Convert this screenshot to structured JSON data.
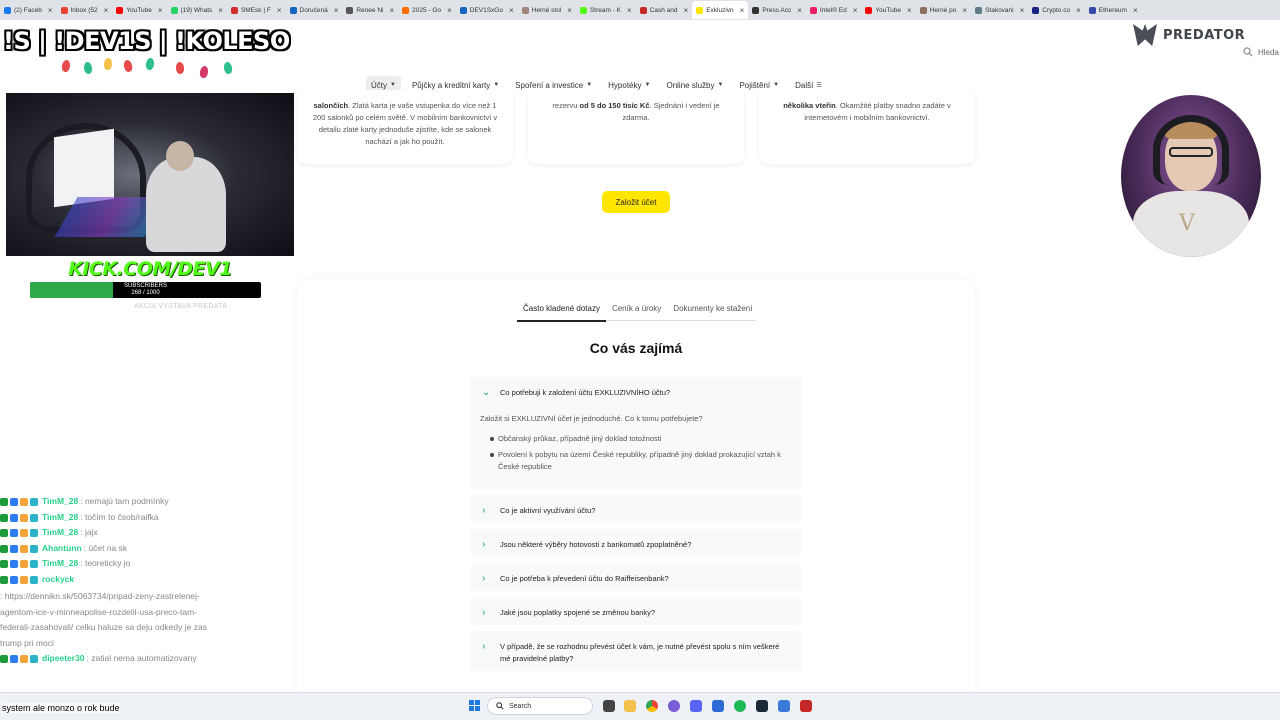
{
  "browser": {
    "tabs": [
      {
        "label": "(2) Faceb",
        "color": "#1877f2"
      },
      {
        "label": "Inbox (52",
        "color": "#ea4335"
      },
      {
        "label": "YouTube",
        "color": "#ff0000"
      },
      {
        "label": "(19) Whats",
        "color": "#25d366"
      },
      {
        "label": "SMEsk | F",
        "color": "#d32f2f"
      },
      {
        "label": "Doručená",
        "color": "#1565c0"
      },
      {
        "label": "Renee Ni",
        "color": "#555555"
      },
      {
        "label": "2025 - Go",
        "color": "#ff6d00"
      },
      {
        "label": "DEV1SxGo",
        "color": "#1565c0"
      },
      {
        "label": "Herné stol",
        "color": "#a1887f"
      },
      {
        "label": "Stream - K",
        "color": "#53fc18"
      },
      {
        "label": "Cash and",
        "color": "#c62828"
      },
      {
        "label": "Exkluzivn",
        "color": "#ffe600",
        "active": true
      },
      {
        "label": "Press Acc",
        "color": "#333333"
      },
      {
        "label": "Intel® Ed",
        "color": "#e91e63"
      },
      {
        "label": "YouTube",
        "color": "#ff0000"
      },
      {
        "label": "Herné po",
        "color": "#8d6e63"
      },
      {
        "label": "Stakovani",
        "color": "#607d8b"
      },
      {
        "label": "Crypto.co",
        "color": "#1a237e"
      },
      {
        "label": "Ethereum",
        "color": "#3949ab"
      }
    ]
  },
  "overlay": {
    "title": "!S | !DEV1S | !KOLESO",
    "brand": "PREDATOR",
    "kick": "KICK.COM/DEV1",
    "subscribers_label": "SUBSCRIBERS",
    "subscribers_count": "268 / 1000",
    "subscribers_progress": 0.268,
    "watermark": "AKCIA VYSTAVA PREDATA"
  },
  "site": {
    "search_label": "Hleda",
    "nav": [
      {
        "label": "Účty",
        "caret": "▼",
        "active": true
      },
      {
        "label": "Půjčky a kreditní karty",
        "caret": "▼"
      },
      {
        "label": "Spoření a investice",
        "caret": "▼"
      },
      {
        "label": "Hypotéky",
        "caret": "▼"
      },
      {
        "label": "Online služby",
        "caret": "▼"
      },
      {
        "label": "Pojištění",
        "caret": "▼"
      },
      {
        "label": "Další",
        "caret": "☰"
      }
    ],
    "cards": [
      {
        "bold": "salončích",
        "text": ". Zlatá karta je vaše vstupenka do více než 1 200 salonků po celém světě. V mobilním bankovnictví v detailu zlaté karty jednoduše zjistíte, kde se salonek nachází a jak ho použít."
      },
      {
        "pre": "rezervu ",
        "bold": "od 5 do 150 tisíc Kč",
        "text": ". Sjednání i vedení je zdarma."
      },
      {
        "bold": "několika vteřin",
        "text": ". Okamžité platby snadno zadáte v internetovém i mobilním bankovnictví."
      }
    ],
    "cta": "Založit účet",
    "faq_tabs": [
      "Často kladené dotazy",
      "Ceník a úroky",
      "Dokumenty ke stažení"
    ],
    "faq_heading": "Co vás zajímá",
    "faq": [
      {
        "q": "Co potřebuji k založení účtu EXKLUZIVNÍHO účtu?",
        "open": true,
        "intro": "Založit si EXKLUZIVNÍ účet je jednoduché. Co k tomu potřebujete?",
        "bullets": [
          "Občanský průkaz, případně jiný doklad totožnosti",
          "Povolení k pobytu na území České republiky, případně jiný doklad prokazující vztah k České republice"
        ]
      },
      {
        "q": "Co je aktivní využívání účtu?"
      },
      {
        "q": "Jsou některé výběry hotovosti z bankomatů zpoplatněné?"
      },
      {
        "q": "Co je potřeba k převedení účtu do Raiffeisenbank?"
      },
      {
        "q": "Jaké jsou poplatky spojené se změnou banky?"
      },
      {
        "q": "V případě, že se rozhodnu převést účet k vám, je nutné převést spolu s ním veškeré mé pravidelné platby?"
      }
    ]
  },
  "chat": {
    "messages": [
      {
        "user": "TimM_28",
        "text": ": nemajú tam podmínky"
      },
      {
        "user": "TimM_28",
        "text": ": točím to čsob/raifka"
      },
      {
        "user": "TimM_28",
        "text": ": jajx"
      },
      {
        "user": "Ahantunn",
        "text": ": účet na sk"
      },
      {
        "user": "TimM_28",
        "text": ": teoreticky jo"
      },
      {
        "user": "rockyck",
        "text": ": https://dennikn.sk/5063734/pripad-zeny-zastrelenej-agentom-ice-v-minneapolise-rozdelil-usa-preco-tam-federali-zasahovali/ celku haluze sa deju odkedy je zas trump pri moci"
      },
      {
        "user": "dipeeter30",
        "text": ": zatial nema automatizovany"
      }
    ],
    "bottom_line": "system ale monzo o rok bude"
  },
  "taskbar": {
    "search_label": "Search"
  }
}
